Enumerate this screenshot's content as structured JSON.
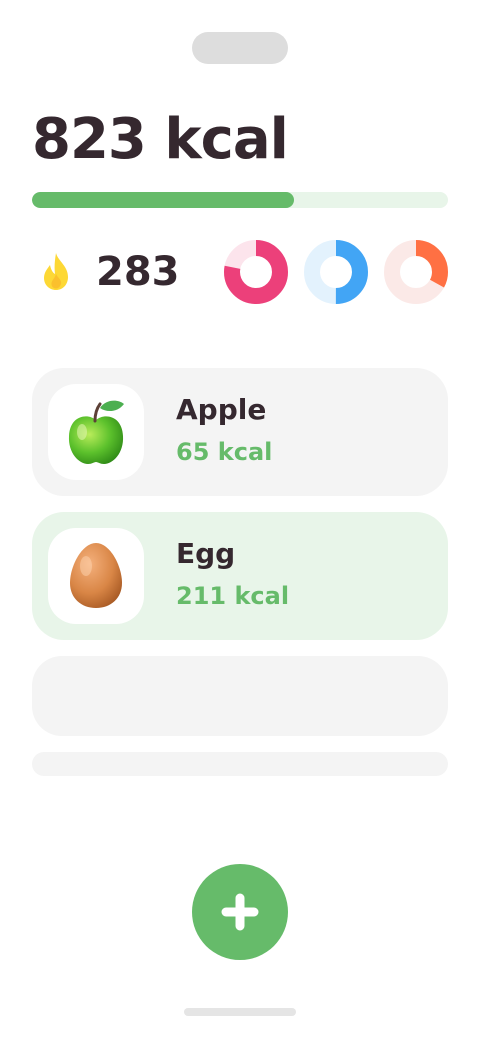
{
  "summary": {
    "total_calories": "823 kcal",
    "progress_fraction": 0.63,
    "burned_value": "283",
    "flame_icon": "flame-icon"
  },
  "macro_rings": [
    {
      "name": "macro-ring-pink",
      "color": "#ec407a",
      "track": "#fce4ec",
      "fraction": 0.78
    },
    {
      "name": "macro-ring-blue",
      "color": "#42a5f5",
      "track": "#e3f2fd",
      "fraction": 0.5
    },
    {
      "name": "macro-ring-orange",
      "color": "#ff7043",
      "track": "#fbe9e7",
      "fraction": 0.33
    }
  ],
  "foods": [
    {
      "name": "Apple",
      "kcal": "65 kcal",
      "icon": "apple-icon",
      "selected": false
    },
    {
      "name": "Egg",
      "kcal": "211 kcal",
      "icon": "egg-icon",
      "selected": true
    }
  ],
  "actions": {
    "add_icon": "plus-icon"
  },
  "colors": {
    "accent": "#66bb6a",
    "accent_light": "#e8f5e9",
    "text": "#35282f",
    "card": "#f4f4f4",
    "flame": "#fdd835"
  }
}
